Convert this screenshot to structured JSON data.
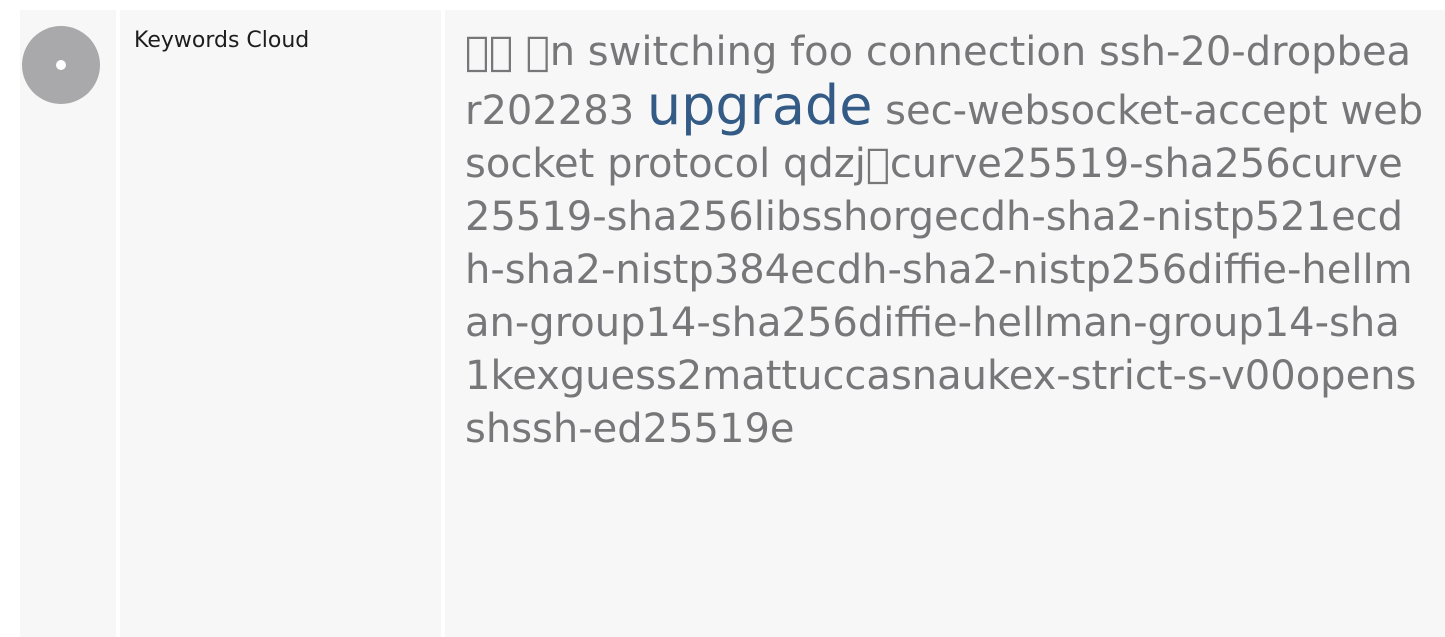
{
  "section": {
    "label": "Keywords Cloud"
  },
  "keywords": {
    "k1": "\u0000\u0000 \u0000n",
    "k2": "switching",
    "k3": "foo",
    "k4": "connection",
    "k5": "ssh-20-dropbear202283",
    "k6": "upgrade",
    "k7": "sec-websocket-accept",
    "k8": "websocket",
    "k9": "protocol",
    "k10": "qdzj\u0000curve25519-sha256curve25519-sha256libsshorgecdh-sha2-nistp521ecdh-sha2-nistp384ecdh-sha2-nistp256diffie-hellman-group14-sha256diffie-hellman-group14-sha1kexguess2mattuccasnaukex-strict-s-v00opensshssh-ed25519e"
  },
  "colors": {
    "accent": "#335b85",
    "text": "#77777a",
    "panel": "#f7f7f7",
    "icon": "#a9a9ab"
  },
  "icons": {
    "row_icon": "disc-icon"
  }
}
